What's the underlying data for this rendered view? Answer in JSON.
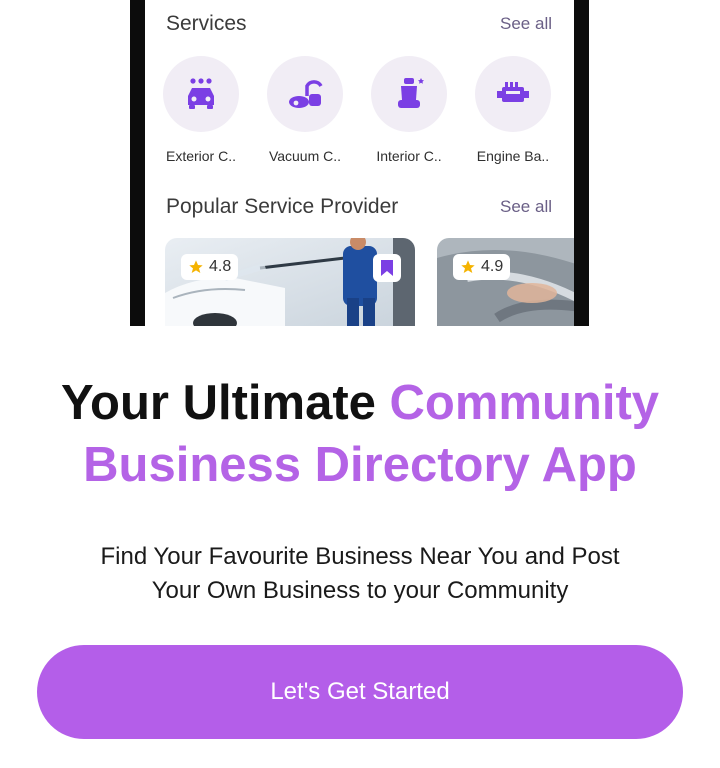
{
  "services": {
    "title": "Services",
    "see_all": "See all",
    "items": [
      {
        "label": "Exterior C..",
        "icon": "car-wash-icon"
      },
      {
        "label": "Vacuum C..",
        "icon": "vacuum-icon"
      },
      {
        "label": "Interior C..",
        "icon": "car-seat-icon"
      },
      {
        "label": "Engine Ba..",
        "icon": "engine-icon"
      }
    ]
  },
  "popular": {
    "title": "Popular Service Provider",
    "see_all": "See all",
    "cards": [
      {
        "rating": "4.8"
      },
      {
        "rating": "4.9"
      }
    ]
  },
  "headline": {
    "part1": "Your Ultimate ",
    "part2": "Community Business Directory App"
  },
  "subtitle": {
    "line1": "Find Your Favourite Business Near You and Post",
    "line2": "Your Own Business to your Community"
  },
  "cta": {
    "label": "Let's Get Started"
  },
  "colors": {
    "accent": "#b463e6",
    "icon": "#7b3fe4",
    "star": "#f5b301"
  }
}
